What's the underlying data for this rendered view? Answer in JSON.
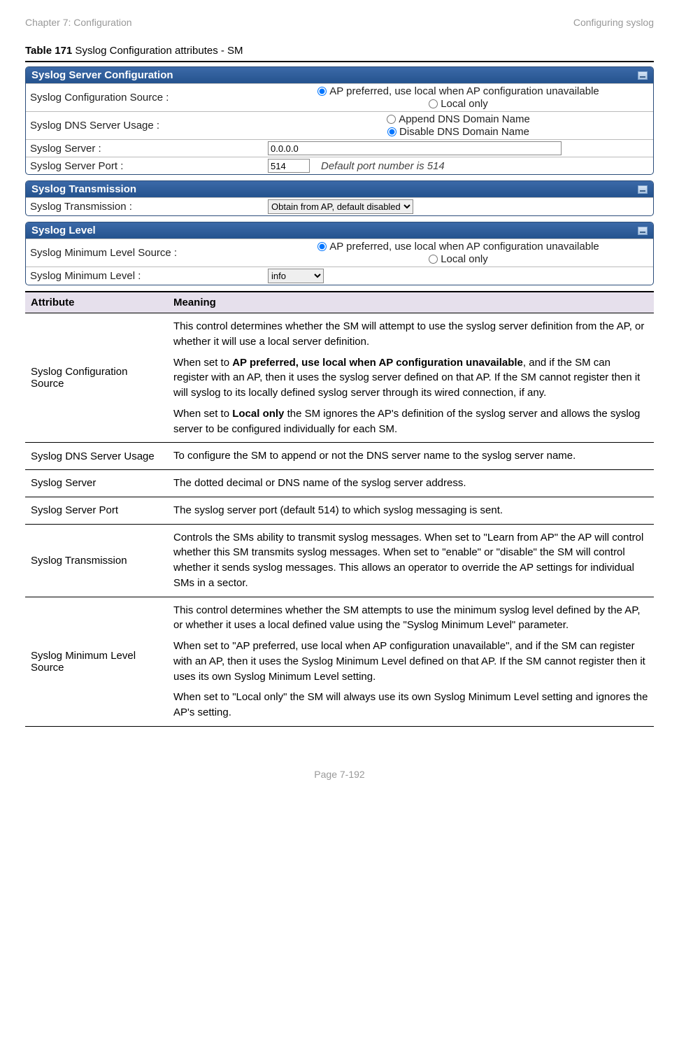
{
  "header": {
    "left": "Chapter 7:  Configuration",
    "right": "Configuring syslog"
  },
  "caption": {
    "bold": "Table 171",
    "rest": " Syslog Configuration attributes - SM"
  },
  "box1": {
    "title": "Syslog Server Configuration",
    "rows": {
      "cfgSourceLabel": "Syslog Configuration Source :",
      "cfgSourceOpt1": "AP preferred, use local when AP configuration unavailable",
      "cfgSourceOpt2": "Local only",
      "dnsLabel": "Syslog DNS Server Usage :",
      "dnsOpt1": "Append DNS Domain Name",
      "dnsOpt2": "Disable DNS Domain Name",
      "serverLabel": "Syslog Server :",
      "serverVal": "0.0.0.0",
      "portLabel": "Syslog Server Port :",
      "portVal": "514",
      "portHint": "Default port number is 514"
    }
  },
  "box2": {
    "title": "Syslog Transmission",
    "label": "Syslog Transmission :",
    "select": "Obtain from AP, default disabled"
  },
  "box3": {
    "title": "Syslog Level",
    "srcLabel": "Syslog Minimum Level Source :",
    "srcOpt1": "AP preferred, use local when AP configuration unavailable",
    "srcOpt2": "Local only",
    "minLabel": "Syslog Minimum Level :",
    "minSelect": "info"
  },
  "attrHead": {
    "c1": "Attribute",
    "c2": "Meaning"
  },
  "attrs": [
    {
      "name": "Syslog Configuration Source",
      "p1": "This control determines whether the SM will attempt to use the syslog server definition from the AP, or whether it will use a local server definition.",
      "p2a": "When set to ",
      "p2b": "AP preferred, use local when AP configuration unavailable",
      "p2c": ", and if the SM can register with an AP, then it uses the syslog server defined on that AP. If the SM cannot register then it will syslog to its locally defined syslog server through its wired connection, if any.",
      "p3a": "When set to ",
      "p3b": "Local only",
      "p3c": " the SM ignores the AP's definition of the syslog server and allows the syslog server to be configured individually for each SM."
    },
    {
      "name": "Syslog DNS Server Usage",
      "p1": "To configure the SM to append or not the DNS server name to the syslog server name."
    },
    {
      "name": "Syslog Server",
      "p1": "The dotted decimal or DNS name of the syslog server address."
    },
    {
      "name": "Syslog Server Port",
      "p1": "The syslog server port (default 514) to which syslog messaging is sent."
    },
    {
      "name": "Syslog Transmission",
      "p1": "Controls the SMs ability to transmit syslog messages. When set to \"Learn from AP\" the AP will control whether this SM transmits syslog messages. When set to \"enable\" or \"disable\" the SM will control whether it sends syslog messages. This allows an operator to override the AP settings for individual SMs in a sector."
    },
    {
      "name": "Syslog Minimum Level Source",
      "p1": "This control determines whether the SM attempts to use the minimum syslog level defined by the AP, or whether it uses a local defined value using the \"Syslog Minimum Level\" parameter.",
      "p2": "When set to \"AP preferred, use local when AP configuration unavailable\", and if the SM can register with an AP, then it uses the Syslog Minimum Level defined on that AP. If the SM cannot register then it uses its own Syslog Minimum Level setting.",
      "p3": "When set to \"Local only\" the SM will always use its own Syslog Minimum Level setting and ignores the AP's setting."
    }
  ],
  "footer": "Page 7-192"
}
